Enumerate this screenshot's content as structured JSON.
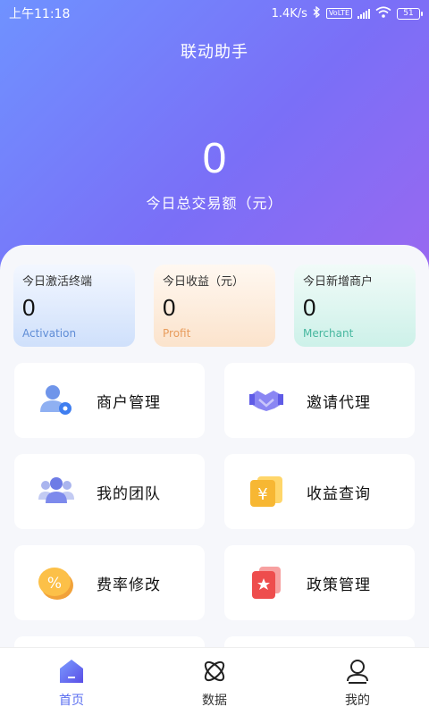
{
  "status": {
    "time": "上午11:18",
    "speed": "1.4K/s",
    "volte": "VoLTE",
    "battery": "51"
  },
  "header": {
    "title": "联动助手"
  },
  "summary": {
    "amount": "0",
    "label": "今日总交易额（元）"
  },
  "stats": [
    {
      "label": "今日激活终端",
      "value": "0",
      "en": "Activation"
    },
    {
      "label": "今日收益（元）",
      "value": "0",
      "en": "Profit"
    },
    {
      "label": "今日新增商户",
      "value": "0",
      "en": "Merchant"
    }
  ],
  "menu": [
    {
      "label": "商户管理",
      "icon": "merchant-icon"
    },
    {
      "label": "邀请代理",
      "icon": "handshake-icon"
    },
    {
      "label": "我的团队",
      "icon": "team-icon"
    },
    {
      "label": "收益查询",
      "icon": "yen-icon"
    },
    {
      "label": "费率修改",
      "icon": "percent-icon"
    },
    {
      "label": "政策管理",
      "icon": "policy-icon"
    }
  ],
  "tabs": [
    {
      "label": "首页",
      "icon": "home-icon"
    },
    {
      "label": "数据",
      "icon": "data-icon"
    },
    {
      "label": "我的",
      "icon": "profile-icon"
    }
  ],
  "colors": {
    "accent": "#5a6ef0",
    "hero_start": "#6f92ff",
    "hero_end": "#9a68f0"
  }
}
